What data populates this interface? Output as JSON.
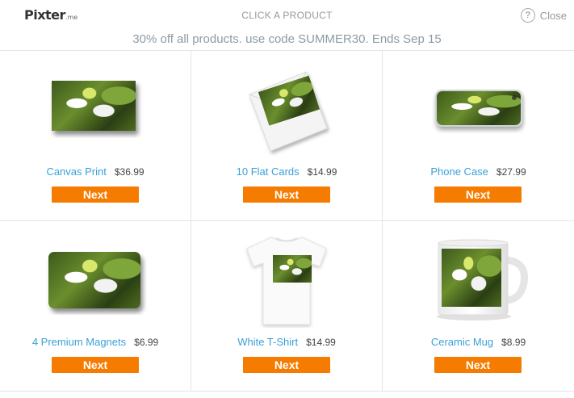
{
  "header": {
    "logo": "Pixter",
    "logo_suffix": ".me",
    "title": "CLICK A PRODUCT",
    "close_label": "Close",
    "help_glyph": "?"
  },
  "promo": "30% off all products. use code SUMMER30. Ends Sep 15",
  "products": [
    {
      "name": "Canvas Print",
      "price": "$36.99",
      "button": "Next",
      "icon": "canvas-print-image"
    },
    {
      "name": "10 Flat Cards",
      "price": "$14.99",
      "button": "Next",
      "icon": "flat-cards-image"
    },
    {
      "name": "Phone Case",
      "price": "$27.99",
      "button": "Next",
      "icon": "phone-case-image"
    },
    {
      "name": "4 Premium Magnets",
      "price": "$6.99",
      "button": "Next",
      "icon": "magnets-image"
    },
    {
      "name": "White T-Shirt",
      "price": "$14.99",
      "button": "Next",
      "icon": "tshirt-image"
    },
    {
      "name": "Ceramic Mug",
      "price": "$8.99",
      "button": "Next",
      "icon": "mug-image"
    }
  ],
  "colors": {
    "accent": "#f57c00",
    "link": "#3aa0d8",
    "promo_text": "#8c9ba5"
  }
}
